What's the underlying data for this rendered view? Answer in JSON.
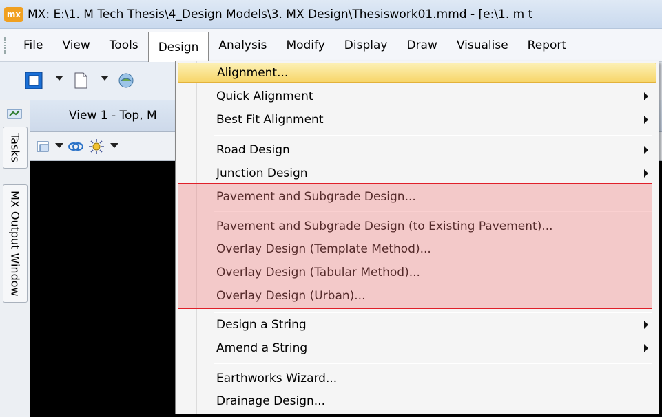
{
  "window": {
    "logo_text": "mx",
    "title": "MX: E:\\1. M Tech Thesis\\4_Design Models\\3. MX Design\\Thesiswork01.mmd - [e:\\1. m t"
  },
  "menubar": {
    "items": [
      "File",
      "View",
      "Tools",
      "Design",
      "Analysis",
      "Modify",
      "Display",
      "Draw",
      "Visualise",
      "Report"
    ],
    "active": "Design"
  },
  "sidebar": {
    "tabs": [
      "Tasks",
      "MX Output Window"
    ]
  },
  "view": {
    "title": "View 1 - Top, M"
  },
  "design_menu": {
    "items": [
      {
        "label": "Alignment...",
        "submenu": false,
        "highlighted": true
      },
      {
        "label": "Quick Alignment",
        "submenu": true
      },
      {
        "label": "Best Fit Alignment",
        "submenu": true
      },
      {
        "label": "Road Design",
        "submenu": true
      },
      {
        "label": "Junction Design",
        "submenu": true
      },
      {
        "label": "Pavement and Subgrade Design...",
        "submenu": false
      },
      {
        "label": "Pavement and Subgrade Design (to Existing Pavement)...",
        "submenu": false
      },
      {
        "label": "Overlay Design (Template Method)...",
        "submenu": false
      },
      {
        "label": "Overlay Design (Tabular Method)...",
        "submenu": false
      },
      {
        "label": "Overlay Design (Urban)...",
        "submenu": false
      },
      {
        "label": "Design a String",
        "submenu": true
      },
      {
        "label": "Amend a String",
        "submenu": true
      },
      {
        "label": "Earthworks Wizard...",
        "submenu": false
      },
      {
        "label": "Drainage Design...",
        "submenu": false
      }
    ]
  },
  "colors": {
    "highlight": "#f7d66a",
    "annotation_box": "#e0202a",
    "viewport": "#000000"
  }
}
